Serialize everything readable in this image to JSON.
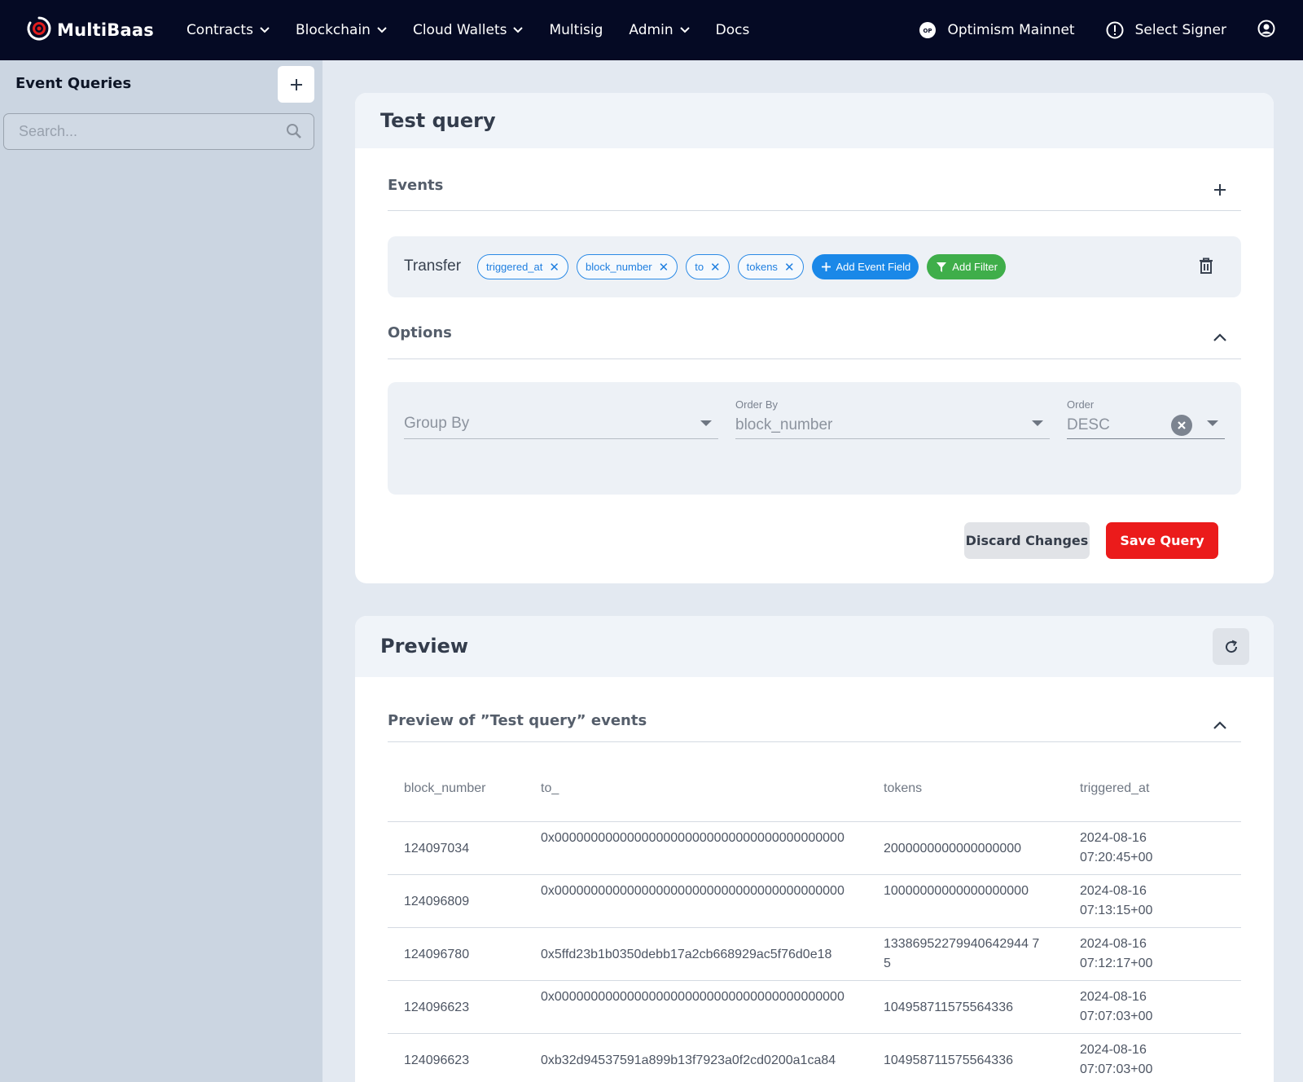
{
  "nav": {
    "brand": "MultiBaas",
    "items": [
      {
        "label": "Contracts",
        "dropdown": true
      },
      {
        "label": "Blockchain",
        "dropdown": true
      },
      {
        "label": "Cloud Wallets",
        "dropdown": true
      },
      {
        "label": "Multisig",
        "dropdown": false
      },
      {
        "label": "Admin",
        "dropdown": true
      },
      {
        "label": "Docs",
        "dropdown": false
      }
    ],
    "network": "Optimism Mainnet",
    "signer": "Select Signer"
  },
  "sidebar": {
    "title": "Event Queries",
    "search_placeholder": "Search..."
  },
  "query": {
    "title": "Test query",
    "events_title": "Events",
    "event": {
      "name": "Transfer",
      "fields": [
        "triggered_at",
        "block_number",
        "to",
        "tokens"
      ],
      "add_field_label": "Add Event Field",
      "add_filter_label": "Add Filter"
    },
    "options_title": "Options",
    "group_by": {
      "placeholder": "Group By"
    },
    "order_by": {
      "label": "Order By",
      "value": "block_number"
    },
    "order": {
      "label": "Order",
      "value": "DESC"
    },
    "discard_label": "Discard Changes",
    "save_label": "Save Query"
  },
  "preview": {
    "title": "Preview",
    "section_title": "Preview of ”Test query” events",
    "columns": [
      "block_number",
      "to_",
      "tokens",
      "triggered_at"
    ],
    "rows": [
      {
        "block_number": "124097034",
        "to": "0x0000000000000000000000000000000000000000",
        "tokens": "2000000000000000000",
        "triggered_at": "2024-08-16 07:20:45+00"
      },
      {
        "block_number": "124096809",
        "to": "0x0000000000000000000000000000000000000000",
        "tokens": "10000000000000000000",
        "triggered_at": "2024-08-16 07:13:15+00"
      },
      {
        "block_number": "124096780",
        "to": "0x5ffd23b1b0350debb17a2cb668929ac5f76d0e18",
        "tokens": "13386952279940642944 75",
        "triggered_at": "2024-08-16 07:12:17+00"
      },
      {
        "block_number": "124096623",
        "to": "0x0000000000000000000000000000000000000000",
        "tokens": "104958711575564336",
        "triggered_at": "2024-08-16 07:07:03+00"
      },
      {
        "block_number": "124096623",
        "to": "0xb32d94537591a899b13f7923a0f2cd0200a1ca84",
        "tokens": "104958711575564336",
        "triggered_at": "2024-08-16 07:07:03+00"
      }
    ]
  },
  "colors": {
    "nav_bg": "#050a24",
    "accent_red": "#eb1b1b",
    "chip_blue": "#1a88e8",
    "chip_green": "#3fae4a"
  }
}
